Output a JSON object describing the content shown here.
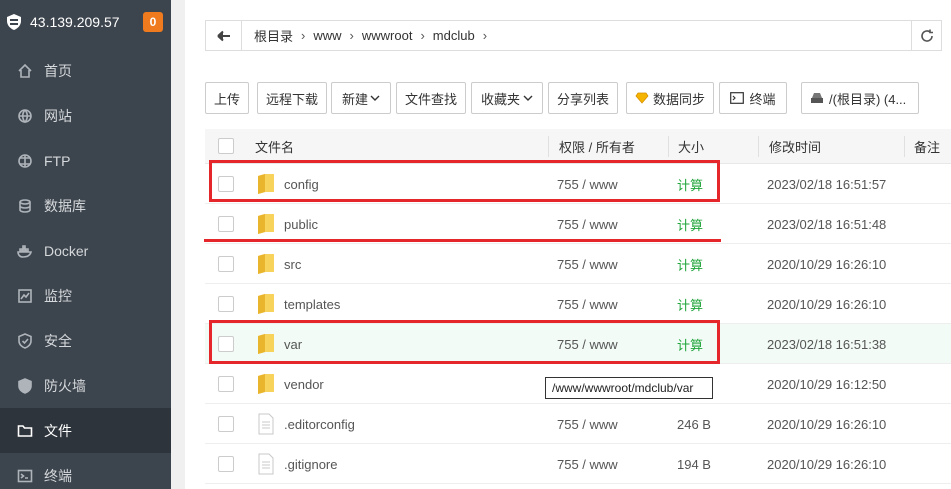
{
  "sidebar": {
    "server_ip": "43.139.209.57",
    "notification_count": "0",
    "items": [
      {
        "label": "首页",
        "icon": "home-icon"
      },
      {
        "label": "网站",
        "icon": "globe-icon"
      },
      {
        "label": "FTP",
        "icon": "ftp-icon"
      },
      {
        "label": "数据库",
        "icon": "database-icon"
      },
      {
        "label": "Docker",
        "icon": "docker-icon"
      },
      {
        "label": "监控",
        "icon": "monitor-icon"
      },
      {
        "label": "安全",
        "icon": "shield-icon"
      },
      {
        "label": "防火墙",
        "icon": "firewall-icon"
      },
      {
        "label": "文件",
        "icon": "folder-icon"
      },
      {
        "label": "终端",
        "icon": "terminal-icon"
      }
    ],
    "active": "文件"
  },
  "pathbar": {
    "crumbs": [
      "根目录",
      "www",
      "wwwroot",
      "mdclub"
    ]
  },
  "toolbar": {
    "upload": "上传",
    "remote_download": "远程下载",
    "new": "新建",
    "file_search": "文件查找",
    "favorites": "收藏夹",
    "share_list": "分享列表",
    "data_sync": "数据同步",
    "terminal": "终端",
    "disk": "/(根目录) (4..."
  },
  "table": {
    "headers": {
      "name": "文件名",
      "perm": "权限 / 所有者",
      "size": "大小",
      "mtime": "修改时间",
      "note": "备注"
    },
    "rows": [
      {
        "name": "config",
        "type": "folder",
        "perm": "755 / www",
        "size": "计算",
        "mtime": "2023/02/18 16:51:57"
      },
      {
        "name": "public",
        "type": "folder",
        "perm": "755 / www",
        "size": "计算",
        "mtime": "2023/02/18 16:51:48"
      },
      {
        "name": "src",
        "type": "folder",
        "perm": "755 / www",
        "size": "计算",
        "mtime": "2020/10/29 16:26:10"
      },
      {
        "name": "templates",
        "type": "folder",
        "perm": "755 / www",
        "size": "计算",
        "mtime": "2020/10/29 16:26:10"
      },
      {
        "name": "var",
        "type": "folder",
        "perm": "755 / www",
        "size": "计算",
        "mtime": "2023/02/18 16:51:38"
      },
      {
        "name": "vendor",
        "type": "folder",
        "perm": "",
        "size": "",
        "mtime": "2020/10/29 16:12:50"
      },
      {
        "name": ".editorconfig",
        "type": "file",
        "perm": "755 / www",
        "size": "246 B",
        "mtime": "2020/10/29 16:26:10"
      },
      {
        "name": ".gitignore",
        "type": "file",
        "perm": "755 / www",
        "size": "194 B",
        "mtime": "2020/10/29 16:26:10"
      }
    ]
  },
  "tooltip": "/www/wwwroot/mdclub/var",
  "colors": {
    "sidebar_bg": "#3c444d",
    "accent_green": "#20a53a",
    "highlight_red": "#e5262b",
    "badge_orange": "#ef7b1e"
  }
}
